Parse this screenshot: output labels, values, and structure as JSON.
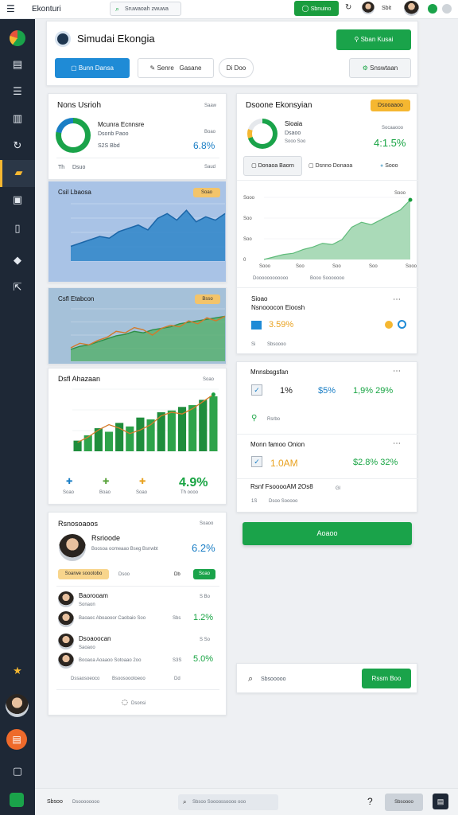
{
  "topbar": {
    "app_name": "Ekonturi",
    "search_text": "Sruwaoah zwuwa",
    "action_label": "Sbnuino",
    "user_label": "Sbit"
  },
  "header": {
    "title": "Simudai Ekongia",
    "primary_button": "Sban Kusai",
    "tabs": [
      {
        "label": "Bunn Dansa"
      },
      {
        "label": "Senre"
      },
      {
        "label": "Gasane"
      },
      {
        "label": "Di Doo"
      },
      {
        "label": "Snswtaan"
      }
    ]
  },
  "left": {
    "summary": {
      "title": "Nons Usrioh",
      "link": "Saaw",
      "name": "Mcunra Ecnnsre",
      "sub": "Dsonb Paoo",
      "meta1": "Boao",
      "meta2": "S2S Bbd",
      "value": "6.8%",
      "foot_label": "Dsuo",
      "foot_icon": "Th",
      "foot_link": "Saud"
    },
    "chart1": {
      "title": "Csil Lbaosa",
      "badge": "Soao"
    },
    "chart2": {
      "title": "Csfl Etabcon",
      "badge": "Bsso"
    },
    "chart3": {
      "title": "Dsfl Ahazaan",
      "link": "Soao",
      "stats": [
        {
          "label": "Soao",
          "color": "#1a7ec5"
        },
        {
          "label": "Boao",
          "color": "#5aa33c"
        },
        {
          "label": "Soao",
          "color": "#e9a220"
        }
      ],
      "big_value": "4.9%",
      "big_sub": "Th oooo"
    },
    "team": {
      "title": "Rsnosoaoos",
      "link": "Soaoo",
      "person_name": "Rsrioode",
      "person_sub": "Boosoa oomeaao Bseg Bsnwbt",
      "person_value": "6.2%",
      "chips": [
        "Soarwe soootobo",
        "Dsoo",
        "Db",
        "Soao"
      ],
      "list": [
        {
          "name": "Baorooam",
          "sub": "Sonaon",
          "meta": "S Bo",
          "value": ""
        },
        {
          "name": "",
          "sub": "Baoaoc Aboaooor Caobaio Soo",
          "meta": "Sbs",
          "value": "1.2%"
        },
        {
          "name": "Dsoaoocan",
          "sub": "Saoaoo",
          "meta": "S So",
          "value": ""
        },
        {
          "name": "",
          "sub": "Booaoa Aoaaoo Sotoaao 2oo",
          "meta": "S3S",
          "value": "5.0%"
        }
      ],
      "bottom_links": [
        "Dssaosoeoco",
        "Bsoosoootoeoo",
        "Dd"
      ],
      "footer_link": "Dsonsi"
    }
  },
  "right": {
    "growth": {
      "title": "Dsoone Ekonsyian",
      "badge": "Dsooaaoo",
      "name": "Sioaia",
      "sub": "Dsaoo",
      "meta1": "Socaaooo",
      "meta2": "Sooo Soo",
      "value": "4:1.5%",
      "tabs": [
        "Donaoa Baorn",
        "Dsnno Donaoa",
        "Sooo"
      ]
    },
    "area_chart": {
      "y_ticks": [
        "Sooo",
        "Soo",
        "Soo",
        "0"
      ],
      "x_ticks": [
        "Sooo",
        "Soo",
        "Soo",
        "Soo",
        "Sooo"
      ],
      "badge": "Sooo",
      "legend": [
        "Doooooooooooo",
        "Booo Sooooooo"
      ]
    },
    "status": {
      "title": "Sioao",
      "subtitle": "Nsnooocon Eioosh",
      "value": "3.59%",
      "foot_label": "Sbsoooo",
      "foot_icon": "Si"
    },
    "panel2": {
      "row1": {
        "title": "Mnnsbsgsfan",
        "value_a": "1%",
        "value_b": "$5%",
        "value_c": "1,9% 29%",
        "link": "Rsrbo"
      },
      "row2": {
        "title": "Monn famoo Onion",
        "value_a": "1.0AM",
        "value_c": "$2.8% 32%"
      },
      "row3": {
        "title": "Rsnf FsooooAM 2Os8",
        "meta": "1S",
        "link": "Dsoo Sooooo",
        "sub_value": "Gl"
      }
    },
    "cta_label": "Aoaoo",
    "search": {
      "placeholder": "Sbsooooo",
      "button": "Rssm Boo"
    }
  },
  "bottombar": {
    "left_label": "Sbsoo",
    "left_link": "Dsoooooooo",
    "search": "Sbsoo Soooossoooo ooo",
    "right_label": "Sbsoooo"
  },
  "chart_data": [
    {
      "type": "area",
      "title": "Csil Lbaosa",
      "x": [
        1,
        2,
        3,
        4,
        5,
        6,
        7,
        8,
        9,
        10,
        11,
        12,
        13,
        14,
        15,
        16,
        17
      ],
      "series": [
        {
          "values": [
            18,
            22,
            26,
            30,
            28,
            36,
            40,
            44,
            38,
            52,
            58,
            50,
            62,
            48,
            54,
            50,
            58
          ]
        }
      ],
      "ylim": [
        0,
        70
      ],
      "grid": true
    },
    {
      "type": "line",
      "title": "Csfl Etabcon",
      "x": [
        1,
        2,
        3,
        4,
        5,
        6,
        7,
        8,
        9,
        10,
        11,
        12,
        13,
        14,
        15,
        16,
        17,
        18
      ],
      "series": [
        {
          "values": [
            18,
            24,
            22,
            28,
            32,
            40,
            38,
            45,
            42,
            35,
            44,
            48,
            46,
            54,
            50,
            58,
            54,
            60
          ]
        },
        {
          "values": [
            16,
            20,
            22,
            26,
            30,
            34,
            36,
            40,
            38,
            42,
            44,
            46,
            50,
            52,
            54,
            56,
            58,
            60
          ]
        }
      ],
      "ylim": [
        0,
        70
      ],
      "grid": true
    },
    {
      "type": "bar",
      "title": "Dsfl Ahazaan",
      "categories": [
        "1",
        "2",
        "3",
        "4",
        "5",
        "6",
        "7",
        "8",
        "9",
        "10",
        "11",
        "12",
        "13",
        "14"
      ],
      "values": [
        12,
        18,
        26,
        22,
        32,
        28,
        38,
        36,
        44,
        46,
        50,
        52,
        58,
        62
      ],
      "series": [
        {
          "values": [
            10,
            16,
            24,
            30,
            26,
            20,
            24,
            30,
            40,
            44,
            42,
            48,
            56,
            64
          ]
        }
      ],
      "ylim": [
        0,
        70
      ],
      "grid": true
    },
    {
      "type": "area",
      "title": "Dsoone Ekonsyian",
      "x": [
        1,
        2,
        3,
        4,
        5,
        6,
        7,
        8,
        9,
        10,
        11,
        12,
        13,
        14,
        15,
        16
      ],
      "series": [
        {
          "values": [
            0,
            2,
            4,
            5,
            8,
            10,
            13,
            12,
            16,
            26,
            30,
            28,
            32,
            36,
            40,
            48
          ]
        }
      ],
      "ylim": [
        0,
        50
      ],
      "grid": true
    }
  ]
}
